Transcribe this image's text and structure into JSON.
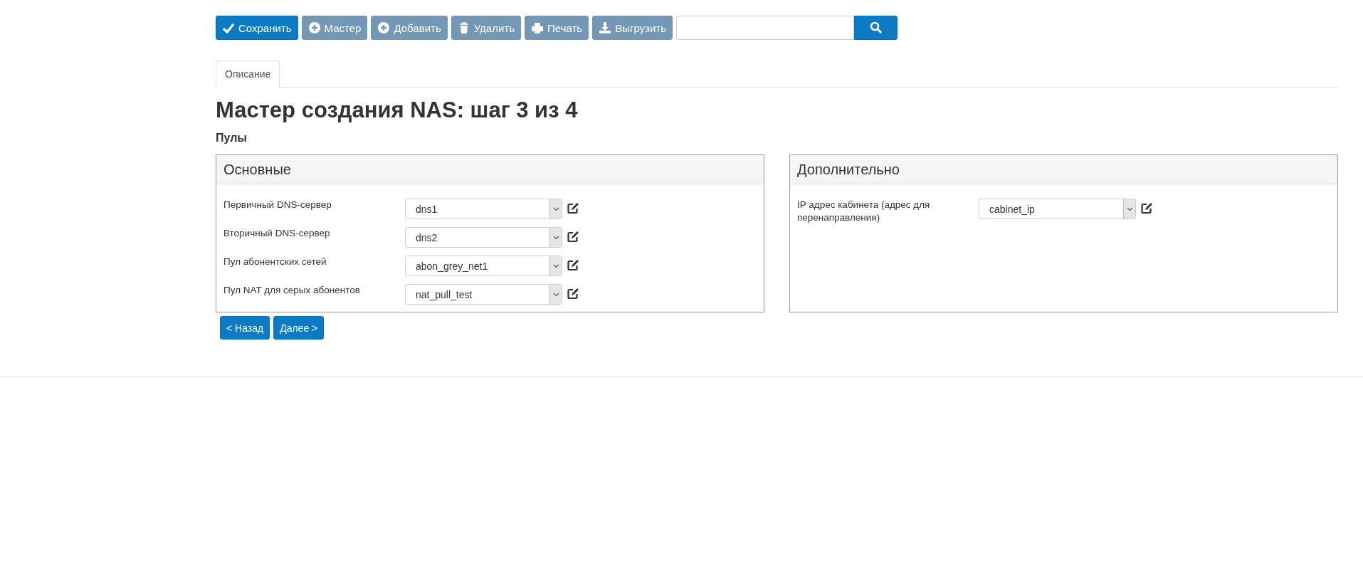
{
  "toolbar": {
    "buttons": [
      {
        "label": "Сохранить",
        "kind": "check",
        "disabled": false
      },
      {
        "label": "Мастер",
        "kind": "plus",
        "disabled": true
      },
      {
        "label": "Добавить",
        "kind": "plus",
        "disabled": true
      },
      {
        "label": "Удалить",
        "kind": "trash",
        "disabled": true
      },
      {
        "label": "Печать",
        "kind": "print",
        "disabled": true
      },
      {
        "label": "Выгрузить",
        "kind": "download",
        "disabled": true
      }
    ]
  },
  "tabs": [
    {
      "label": "Описание",
      "selected": true
    }
  ],
  "title": "Мастер создания NAS: шаг 3 из 4",
  "subtitle": "Пулы",
  "panels": [
    {
      "title": "Основные",
      "fields": [
        {
          "label": "Первичный DNS-сервер",
          "value": "dns1"
        },
        {
          "label": "Вторичный DNS-сервер",
          "value": "dns2"
        },
        {
          "label": "Пул абонентских сетей",
          "value": "abon_grey_net1"
        },
        {
          "label": "Пул NAT для серых абонентов",
          "value": "nat_pull_test"
        }
      ]
    },
    {
      "title": "Дополнительно",
      "fields": [
        {
          "label": "IP адрес кабинета (адрес для перенаправления)",
          "value": "cabinet_ip"
        }
      ]
    }
  ],
  "nav_buttons": [
    "< Назад",
    "Далее >"
  ]
}
